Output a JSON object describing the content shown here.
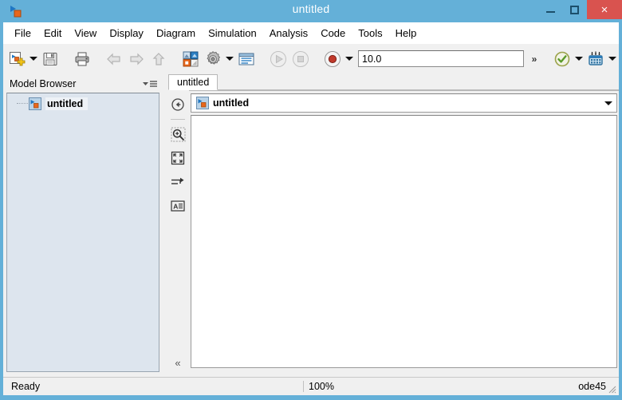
{
  "window": {
    "title": "untitled",
    "app_icon": "simulink-model-icon",
    "controls": {
      "minimize": "minimize-icon",
      "maximize": "maximize-icon",
      "close": "×"
    },
    "colors": {
      "titlebar": "#64b0d8",
      "close_button": "#d9534f",
      "toolbar_bg": "#f0f0f0",
      "tree_bg": "#dde5ee",
      "canvas_bg": "#ffffff"
    }
  },
  "menubar": {
    "items": [
      {
        "label": "File"
      },
      {
        "label": "Edit"
      },
      {
        "label": "View"
      },
      {
        "label": "Display"
      },
      {
        "label": "Diagram"
      },
      {
        "label": "Simulation"
      },
      {
        "label": "Analysis"
      },
      {
        "label": "Code"
      },
      {
        "label": "Tools"
      },
      {
        "label": "Help"
      }
    ]
  },
  "toolbar": {
    "groups": [
      {
        "buttons": [
          {
            "name": "new-model-button",
            "icon": "new-model-icon",
            "has_dropdown": true
          },
          {
            "name": "save-button",
            "icon": "save-floppy-icon",
            "has_dropdown": false
          }
        ]
      },
      {
        "buttons": [
          {
            "name": "print-button",
            "icon": "printer-icon",
            "has_dropdown": false
          }
        ]
      },
      {
        "buttons": [
          {
            "name": "back-button",
            "icon": "arrow-left-icon",
            "has_dropdown": false,
            "disabled": true
          },
          {
            "name": "forward-button",
            "icon": "arrow-right-icon",
            "has_dropdown": false,
            "disabled": true
          },
          {
            "name": "up-to-parent-button",
            "icon": "arrow-up-icon",
            "has_dropdown": false,
            "disabled": true
          }
        ]
      },
      {
        "buttons": [
          {
            "name": "library-browser-button",
            "icon": "library-browser-icon",
            "has_dropdown": false
          },
          {
            "name": "model-configuration-button",
            "icon": "gear-icon",
            "has_dropdown": true
          },
          {
            "name": "model-explorer-button",
            "icon": "model-explorer-icon",
            "has_dropdown": false
          }
        ]
      },
      {
        "buttons": [
          {
            "name": "run-button",
            "icon": "play-icon",
            "has_dropdown": false,
            "disabled": true
          },
          {
            "name": "stop-button",
            "icon": "stop-icon",
            "has_dropdown": false,
            "disabled": true
          }
        ]
      },
      {
        "buttons": [
          {
            "name": "simulation-stepping-button",
            "icon": "record-dot-icon",
            "has_dropdown": true
          }
        ]
      }
    ],
    "simulation_time": {
      "value": "10.0",
      "placeholder": "10.0"
    },
    "overflow_label": "»",
    "right_buttons": [
      {
        "name": "model-advisor-button",
        "icon": "check-circle-icon",
        "has_dropdown": true
      },
      {
        "name": "build-model-button",
        "icon": "build-code-icon",
        "has_dropdown": true
      }
    ]
  },
  "browser": {
    "title": "Model Browser",
    "menu_icon": "panel-menu-icon",
    "tree": [
      {
        "label": "untitled",
        "icon": "simulink-model-icon",
        "selected": true
      }
    ]
  },
  "editor": {
    "tabs": [
      {
        "label": "untitled",
        "active": true
      }
    ],
    "toolrail": [
      {
        "name": "navigate-up-button",
        "icon": "up-to-parent-circle-icon"
      },
      {
        "name": "zoom-region-button",
        "icon": "zoom-in-icon"
      },
      {
        "name": "fit-to-view-button",
        "icon": "fit-to-view-icon"
      },
      {
        "name": "signal-route-button",
        "icon": "signal-arrow-icon"
      },
      {
        "name": "annotation-button",
        "icon": "text-annotation-icon"
      }
    ],
    "collapse_label": "«",
    "breadcrumb": {
      "icon": "simulink-model-icon",
      "label": "untitled",
      "dropdown_icon": "chevron-down-icon"
    }
  },
  "statusbar": {
    "status": "Ready",
    "zoom": "100%",
    "solver": "ode45"
  }
}
